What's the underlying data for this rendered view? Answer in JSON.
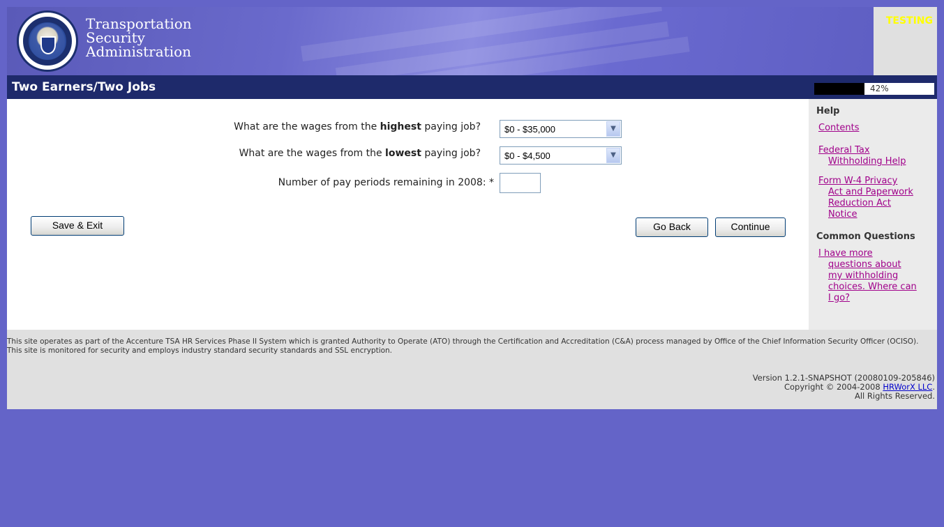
{
  "header": {
    "agency_lines": [
      "Transportation",
      "Security",
      "Administration"
    ],
    "testing_label": "TESTING"
  },
  "title_bar": {
    "title": "Two Earners/Two Jobs",
    "progress_text": "42%",
    "progress_value": 0.42
  },
  "form": {
    "highest_q_pre": "What are the wages from the ",
    "highest_q_bold": "highest",
    "highest_q_post": " paying job?",
    "highest_value": "$0 - $35,000",
    "lowest_q_pre": "What are the wages from the ",
    "lowest_q_bold": "lowest",
    "lowest_q_post": " paying job?",
    "lowest_value": "$0 - $4,500",
    "periods_label": "Number of pay periods remaining in 2008: *",
    "periods_value": ""
  },
  "buttons": {
    "save_exit": "Save & Exit",
    "go_back": "Go Back",
    "continue": "Continue"
  },
  "sidebar": {
    "help_heading": "Help",
    "contents": "Contents",
    "federal_tax": [
      "Federal Tax",
      "Withholding Help"
    ],
    "privacy": [
      "Form W-4 Privacy",
      "Act and Paperwork",
      "Reduction Act",
      "Notice"
    ],
    "common_heading": "Common Questions",
    "question": [
      "I have more",
      "questions about",
      "my withholding",
      "choices. Where can",
      "I go?"
    ]
  },
  "footer": {
    "notice": "This site operates as part of the Accenture TSA HR Services Phase II System which is granted Authority to Operate (ATO) through the Certification and Accreditation (C&A) process managed by Office of the Chief Information Security Officer (OCISO). This site is monitored for security and employs industry standard security standards and SSL encryption.",
    "version": "Version 1.2.1-SNAPSHOT (20080109-205846)",
    "copyright_pre": "Copyright © 2004-2008 ",
    "copyright_link": "HRWorX LLC",
    "copyright_post": ".",
    "rights": "All Rights Reserved."
  },
  "colors": {
    "background": "#6464c8",
    "title_bar": "#1e2a6b",
    "link": "#a0008a",
    "testing": "#ffff00"
  }
}
